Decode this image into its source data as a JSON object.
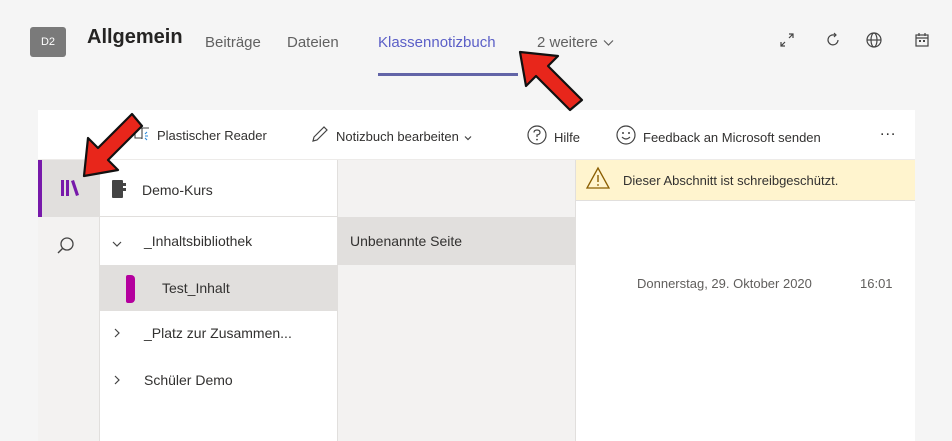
{
  "header": {
    "avatar": "D2",
    "channel": "Allgemein",
    "tabs": [
      {
        "label": "Beiträge"
      },
      {
        "label": "Dateien"
      },
      {
        "label": "Klassennotizbuch"
      },
      {
        "label": "2 weitere"
      }
    ],
    "icons": [
      "expand-icon",
      "refresh-icon",
      "globe-icon",
      "calendar-icon"
    ]
  },
  "toolbar": {
    "reader": "Plastischer Reader",
    "edit": "Notizbuch bearbeiten",
    "help": "Hilfe",
    "feedback": "Feedback an Microsoft senden",
    "more": "..."
  },
  "notebook": {
    "name": "Demo-Kurs",
    "sections": [
      {
        "label": "_Inhaltsbibliothek"
      },
      {
        "label": "Test_Inhalt"
      },
      {
        "label": "_Platz zur Zusammen..."
      },
      {
        "label": "Schüler Demo"
      }
    ]
  },
  "pages": {
    "items": [
      {
        "label": "Unbenannte Seite"
      }
    ]
  },
  "content": {
    "warning": "Dieser Abschnitt ist schreibgeschützt.",
    "date": "Donnerstag, 29. Oktober 2020",
    "time": "16:01"
  },
  "colors": {
    "accent": "#6264a7",
    "section_accent": "#7719aa",
    "annotation_arrow": "#e8261b"
  }
}
